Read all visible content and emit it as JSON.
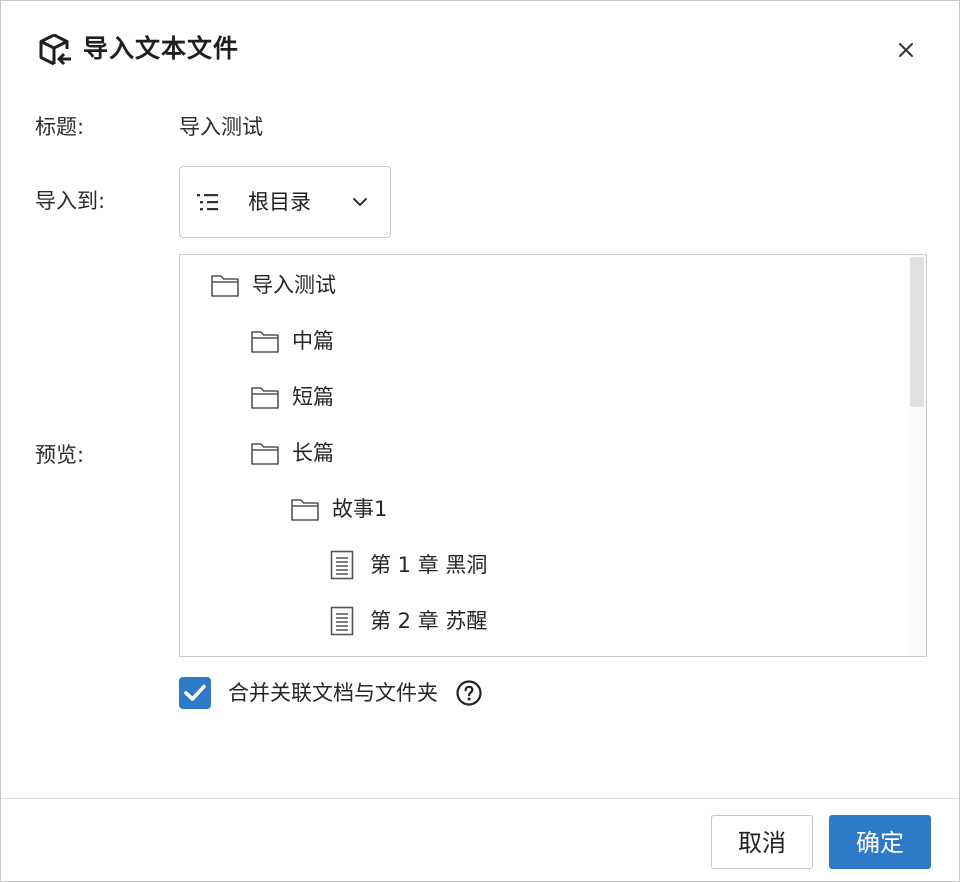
{
  "dialog": {
    "title": "导入文本文件",
    "title_icon": "import-box-icon",
    "close_icon": "close-icon"
  },
  "form": {
    "title_label": "标题:",
    "title_value": "导入测试",
    "import_to_label": "导入到:",
    "import_to_value": "根目录",
    "preview_label": "预览:"
  },
  "tree": [
    {
      "label": "导入测试",
      "type": "folder",
      "depth": 0
    },
    {
      "label": "中篇",
      "type": "folder",
      "depth": 1
    },
    {
      "label": "短篇",
      "type": "folder",
      "depth": 1
    },
    {
      "label": "长篇",
      "type": "folder",
      "depth": 1
    },
    {
      "label": "故事1",
      "type": "folder",
      "depth": 2
    },
    {
      "label": "第 1 章 黑洞",
      "type": "document",
      "depth": 3
    },
    {
      "label": "第 2 章 苏醒",
      "type": "document",
      "depth": 3
    }
  ],
  "options": {
    "merge_label": "合并关联文档与文件夹",
    "merge_checked": true
  },
  "footer": {
    "cancel_label": "取消",
    "confirm_label": "确定"
  },
  "colors": {
    "accent": "#2f79c9",
    "border": "#c9c9c9"
  }
}
